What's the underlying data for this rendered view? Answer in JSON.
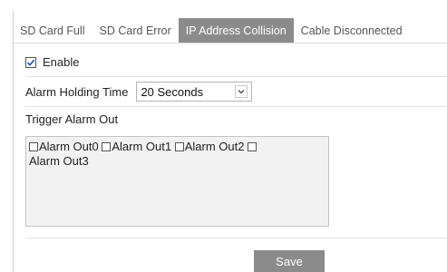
{
  "tabs": [
    {
      "label": "SD Card Full",
      "active": false
    },
    {
      "label": "SD Card Error",
      "active": false
    },
    {
      "label": "IP Address Collision",
      "active": true
    },
    {
      "label": "Cable Disconnected",
      "active": false
    }
  ],
  "enable": {
    "label": "Enable",
    "checked": true
  },
  "holding": {
    "label": "Alarm Holding Time",
    "selected": "20 Seconds"
  },
  "trigger": {
    "label": "Trigger Alarm Out",
    "outputs": [
      {
        "label": "Alarm Out0",
        "checked": false
      },
      {
        "label": "Alarm Out1",
        "checked": false
      },
      {
        "label": "Alarm Out2",
        "checked": false
      },
      {
        "label": "Alarm Out3",
        "checked": false
      }
    ]
  },
  "save_label": "Save",
  "colors": {
    "active_tab": "#8b8b8b",
    "button": "#8b8b8b"
  }
}
